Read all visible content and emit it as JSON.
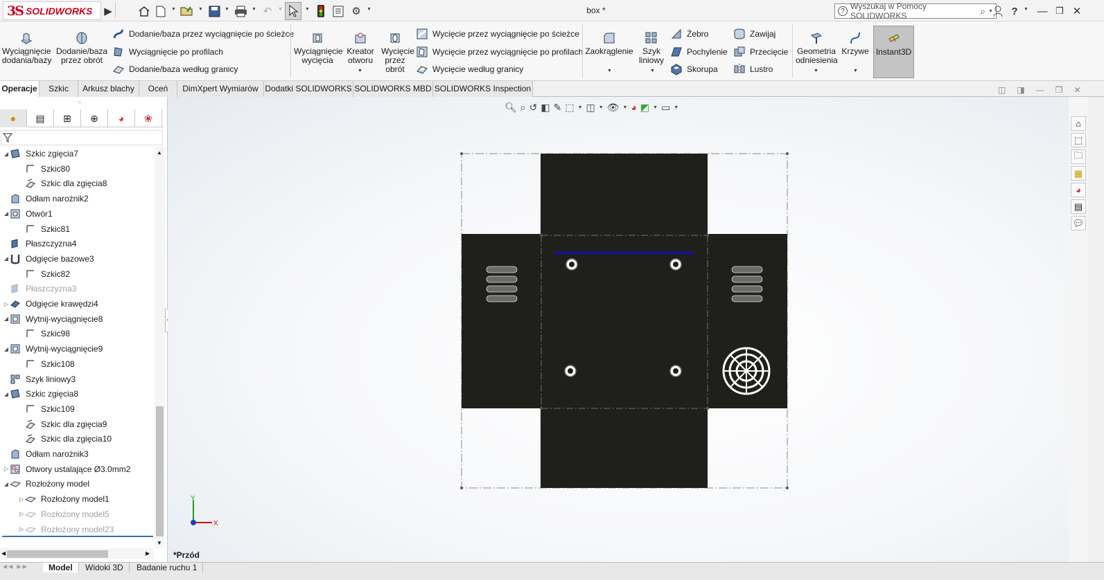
{
  "app": {
    "brand": "SOLIDWORKS",
    "doc_title": "box *"
  },
  "search": {
    "placeholder": "Wyszukaj w Pomocy SOLIDWORKS"
  },
  "ribbon": {
    "extrude_boss": "Wyciągnięcie dodania/bazy",
    "revolve_boss": "Dodanie/baza przez obrót",
    "swept_boss": "Dodanie/baza przez wyciągnięcie po ścieżce",
    "lofted_boss": "Wyciągnięcie po profilach",
    "boundary_boss": "Dodanie/baza według granicy",
    "extrude_cut": "Wyciągnięcie wycięcia",
    "hole_wizard": "Kreator otworu",
    "revolve_cut": "Wycięcie przez obrót",
    "swept_cut": "Wycięcie przez wyciągnięcie po ścieżce",
    "lofted_cut": "Wycięcie przez wyciągnięcie po profilach",
    "boundary_cut": "Wycięcie według granicy",
    "fillet": "Zaokrąglenie",
    "linear_pattern": "Szyk liniowy",
    "rib": "Żebro",
    "draft": "Pochylenie",
    "shell": "Skorupa",
    "wrap": "Zawijaj",
    "intersect": "Przecięcie",
    "mirror": "Lustro",
    "ref_geometry": "Geometria odniesienia",
    "curves": "Krzywe",
    "instant3d": "Instant3D"
  },
  "tabs": [
    "Operacje",
    "Szkic",
    "Arkusz blachy",
    "Oceń",
    "DimXpert Wymiarów",
    "Dodatki SOLIDWORKS",
    "SOLIDWORKS MBD",
    "SOLIDWORKS Inspection"
  ],
  "tree": [
    {
      "label": "Szkic zgięcia7",
      "icon": "sheetmetal-sketch-icon",
      "depth": 0,
      "expand": "open"
    },
    {
      "label": "Szkic80",
      "icon": "sketch-icon",
      "depth": 1,
      "expand": ""
    },
    {
      "label": "Szkic dla zgięcia8",
      "icon": "bend-sketch-icon",
      "depth": 1,
      "expand": ""
    },
    {
      "label": "Odłam narożnik2",
      "icon": "break-corner-icon",
      "depth": 0,
      "expand": ""
    },
    {
      "label": "Otwór1",
      "icon": "hole-icon",
      "depth": 0,
      "expand": "open"
    },
    {
      "label": "Szkic81",
      "icon": "sketch-icon",
      "depth": 1,
      "expand": ""
    },
    {
      "label": "Płaszczyzna4",
      "icon": "plane-icon",
      "depth": 0,
      "expand": ""
    },
    {
      "label": "Odgięcie bazowe3",
      "icon": "base-flange-icon",
      "depth": 0,
      "expand": "open"
    },
    {
      "label": "Szkic82",
      "icon": "sketch-icon",
      "depth": 1,
      "expand": ""
    },
    {
      "label": "Płaszczyzna3",
      "icon": "plane-icon",
      "depth": 0,
      "expand": "",
      "dim": true
    },
    {
      "label": "Odgięcie krawędzi4",
      "icon": "edge-flange-icon",
      "depth": 0,
      "expand": "closed"
    },
    {
      "label": "Wytnij-wyciągnięcie8",
      "icon": "cut-extrude-icon",
      "depth": 0,
      "expand": "open"
    },
    {
      "label": "Szkic98",
      "icon": "sketch-icon",
      "depth": 1,
      "expand": ""
    },
    {
      "label": "Wytnij-wyciągnięcie9",
      "icon": "cut-extrude-icon",
      "depth": 0,
      "expand": "open"
    },
    {
      "label": "Szkic108",
      "icon": "sketch-icon",
      "depth": 1,
      "expand": ""
    },
    {
      "label": "Szyk liniowy3",
      "icon": "linear-pattern-icon",
      "depth": 0,
      "expand": ""
    },
    {
      "label": "Szkic zgięcia8",
      "icon": "sheetmetal-sketch-icon",
      "depth": 0,
      "expand": "open"
    },
    {
      "label": "Szkic109",
      "icon": "sketch-icon",
      "depth": 1,
      "expand": ""
    },
    {
      "label": "Szkic dla zgięcia9",
      "icon": "bend-sketch-icon",
      "depth": 1,
      "expand": ""
    },
    {
      "label": "Szkic dla zgięcia10",
      "icon": "bend-sketch-icon",
      "depth": 1,
      "expand": ""
    },
    {
      "label": "Odłam narożnik3",
      "icon": "break-corner-icon",
      "depth": 0,
      "expand": ""
    },
    {
      "label": "Otwory ustalające Ø3.0mm2",
      "icon": "hole-series-icon",
      "depth": 0,
      "expand": "closed"
    },
    {
      "label": "Rozłożony model",
      "icon": "flat-pattern-icon",
      "depth": 0,
      "expand": "open"
    },
    {
      "label": "Rozłożony model1",
      "icon": "flat-pattern-icon",
      "depth": 1,
      "expand": "closed"
    },
    {
      "label": "Rozłożony model5",
      "icon": "flat-pattern-icon",
      "depth": 1,
      "expand": "closed",
      "dim": true
    },
    {
      "label": "Rozłożony model23",
      "icon": "flat-pattern-icon",
      "depth": 1,
      "expand": "closed",
      "dim": true
    }
  ],
  "viewport": {
    "view_label": "*Przód",
    "axis_x": "X",
    "axis_y": "Y"
  },
  "bottom_tabs": [
    "Model",
    "Widoki 3D",
    "Badanie ruchu 1"
  ],
  "colors": {
    "part": "#1f1f1c",
    "accent": "#d0021b",
    "blue_edge": "#1010b0"
  }
}
